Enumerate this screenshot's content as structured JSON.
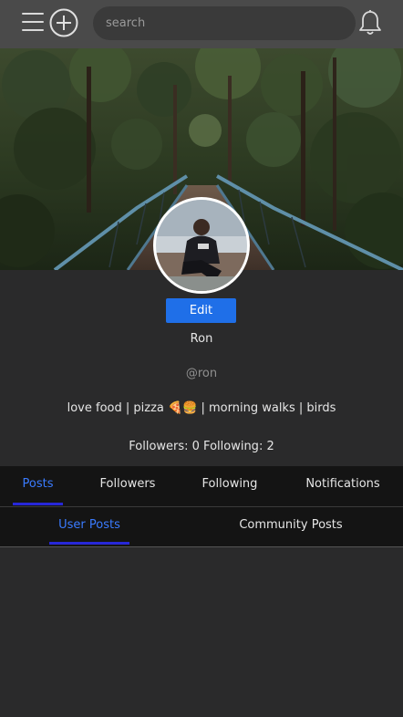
{
  "header": {
    "search_placeholder": "search",
    "icons": [
      "menu-icon",
      "add-circle-icon",
      "bell-icon"
    ]
  },
  "profile": {
    "edit_label": "Edit",
    "name": "Ron",
    "handle": "@ron",
    "bio": "love food | pizza 🍕🍔 | morning walks | birds",
    "stats": "Followers: 0 Following: 2"
  },
  "tabs": [
    {
      "label": "Posts",
      "active": true
    },
    {
      "label": "Followers",
      "active": false
    },
    {
      "label": "Following",
      "active": false
    },
    {
      "label": "Notifications",
      "active": false
    }
  ],
  "subtabs": [
    {
      "label": "User Posts",
      "active": true
    },
    {
      "label": "Community Posts",
      "active": false
    }
  ],
  "colors": {
    "accent": "#1f6fe8",
    "active_tab_text": "#3a7bff",
    "underline": "#2727d8",
    "topbar": "#4a4a4a",
    "background": "#2a2a2b"
  }
}
